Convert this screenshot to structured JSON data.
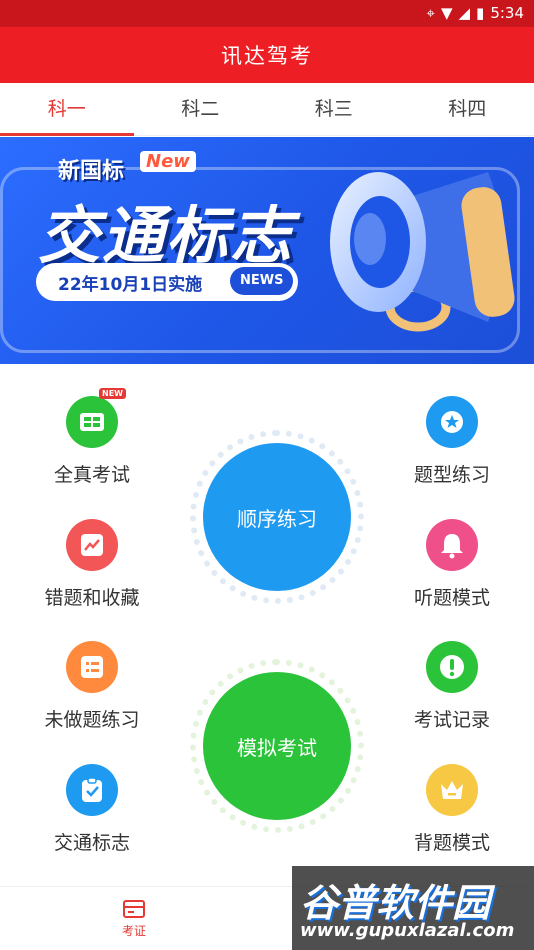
{
  "status_bar": {
    "time": "5:34",
    "icons": [
      "location-icon",
      "wifi-icon",
      "signal-icon",
      "battery-icon"
    ]
  },
  "app_bar": {
    "title": "讯达驾考"
  },
  "tabs": [
    {
      "label": "科一",
      "active": true
    },
    {
      "label": "科二",
      "active": false
    },
    {
      "label": "科三",
      "active": false
    },
    {
      "label": "科四",
      "active": false
    }
  ],
  "banner": {
    "line1": "新国标",
    "new_tag": "New",
    "line2": "交通标志",
    "date": "22年10月1日实施",
    "news_tag": "NEWS"
  },
  "left_items": [
    {
      "label": "全真考试",
      "icon": "exam-card-icon",
      "color": "#2bc33a",
      "badge": "NEW"
    },
    {
      "label": "错题和收藏",
      "icon": "chart-icon",
      "color": "#f25656"
    },
    {
      "label": "未做题练习",
      "icon": "list-icon",
      "color": "#ff8a3d"
    },
    {
      "label": "交通标志",
      "icon": "clipboard-check-icon",
      "color": "#1e9bf0"
    }
  ],
  "right_items": [
    {
      "label": "题型练习",
      "icon": "star-icon",
      "color": "#1e9bf0"
    },
    {
      "label": "听题模式",
      "icon": "bell-icon",
      "color": "#f0508a"
    },
    {
      "label": "考试记录",
      "icon": "alert-icon",
      "color": "#2bc33a"
    },
    {
      "label": "背题模式",
      "icon": "crown-icon",
      "color": "#f7c844"
    }
  ],
  "center_buttons": [
    {
      "label": "顺序练习",
      "color": "#1e9bf0"
    },
    {
      "label": "模拟考试",
      "color": "#2bc33a"
    }
  ],
  "bottom_nav": {
    "label": "考证"
  },
  "watermark": {
    "title": "谷普软件园",
    "url": "www.gupuxlazal.com"
  }
}
